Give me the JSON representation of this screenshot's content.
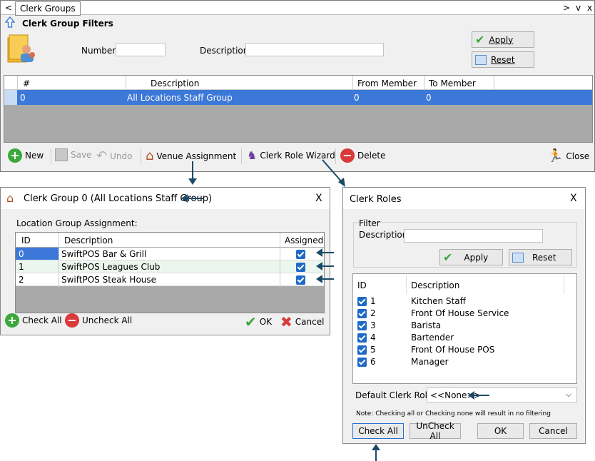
{
  "main": {
    "tab_prev": "<",
    "tab_title": "Clerk Groups",
    "tab_next": ">",
    "tab_menu": "v",
    "tab_close": "x",
    "filters_title": "Clerk Group Filters",
    "number_label": "Number",
    "description_label": "Description",
    "apply_label": "Apply",
    "reset_label": "Reset",
    "columns": [
      "#",
      "Description",
      "From Member",
      "To Member"
    ],
    "row": {
      "num": "0",
      "description": "All Locations Staff Group",
      "from": "0",
      "to": "0"
    },
    "toolbar": {
      "new": "New",
      "save": "Save",
      "undo": "Undo",
      "venue": "Venue Assignment",
      "wizard": "Clerk Role Wizard",
      "delete": "Delete",
      "close": "Close"
    }
  },
  "group_dialog": {
    "title": "Clerk Group 0 (All Locations Staff Group)",
    "close": "X",
    "section": "Location Group Assignment:",
    "columns": [
      "ID",
      "Description",
      "Assigned"
    ],
    "rows": [
      {
        "id": "0",
        "description": "SwiftPOS Bar & Grill"
      },
      {
        "id": "1",
        "description": "SwiftPOS Leagues Club"
      },
      {
        "id": "2",
        "description": "SwiftPOS Steak House"
      }
    ],
    "check_all": "Check All",
    "uncheck_all": "Uncheck All",
    "ok": "OK",
    "cancel": "Cancel"
  },
  "roles_dialog": {
    "title": "Clerk Roles",
    "close": "X",
    "filter_label": "Filter",
    "description_label": "Description",
    "apply": "Apply",
    "reset": "Reset",
    "columns": [
      "ID",
      "Description"
    ],
    "rows": [
      {
        "id": "1",
        "description": "Kitchen Staff"
      },
      {
        "id": "2",
        "description": "Front Of House Service"
      },
      {
        "id": "3",
        "description": "Barista"
      },
      {
        "id": "4",
        "description": "Bartender"
      },
      {
        "id": "5",
        "description": "Front Of House POS"
      },
      {
        "id": "6",
        "description": "Manager"
      }
    ],
    "default_label": "Default Clerk Role:",
    "default_value": "<<None>>",
    "note": "Note: Checking all or Checking none will result in no filtering",
    "check_all": "Check All",
    "uncheck_all": "UnCheck All",
    "ok": "OK",
    "cancel": "Cancel"
  },
  "colors": {
    "selection": "#3c78d8",
    "check": "#1f6ac7",
    "arrow": "#1c4a66"
  }
}
